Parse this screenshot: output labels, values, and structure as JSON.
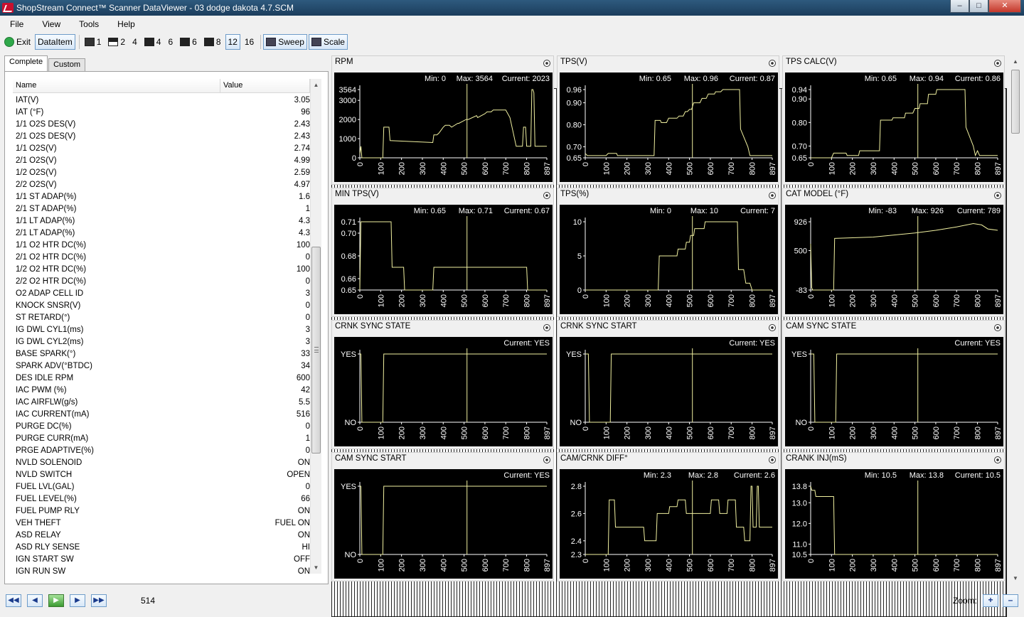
{
  "window": {
    "title": "ShopStream Connect™ Scanner DataViewer - 03 dodge dakota 4.7.SCM"
  },
  "menu": [
    "File",
    "View",
    "Tools",
    "Help"
  ],
  "toolbar": {
    "exit_label": "Exit",
    "dataitem_label": "DataItem",
    "layouts": [
      "1",
      "2",
      "4",
      "4",
      "6",
      "6",
      "8",
      "12",
      "16"
    ],
    "active_layout": "12",
    "sweep_label": "Sweep",
    "scale_label": "Scale"
  },
  "tabs": [
    {
      "label": "Complete",
      "active": true
    },
    {
      "label": "Custom",
      "active": false
    }
  ],
  "list": {
    "headers": {
      "name": "Name",
      "value": "Value"
    },
    "rows": [
      [
        "IAT(V)",
        "3.05"
      ],
      [
        "IAT (°F)",
        "96"
      ],
      [
        "1/1 O2S DES(V)",
        "2.43"
      ],
      [
        "2/1 O2S DES(V)",
        "2.43"
      ],
      [
        "1/1 O2S(V)",
        "2.74"
      ],
      [
        "2/1 O2S(V)",
        "4.99"
      ],
      [
        "1/2 O2S(V)",
        "2.59"
      ],
      [
        "2/2 O2S(V)",
        "4.97"
      ],
      [
        "1/1 ST ADAP(%)",
        "1.6"
      ],
      [
        "2/1 ST ADAP(%)",
        "1"
      ],
      [
        "1/1 LT ADAP(%)",
        "4.3"
      ],
      [
        "2/1 LT ADAP(%)",
        "4.3"
      ],
      [
        "1/1 O2 HTR DC(%)",
        "100"
      ],
      [
        "2/1 O2 HTR DC(%)",
        "0"
      ],
      [
        "1/2 O2 HTR DC(%)",
        "100"
      ],
      [
        "2/2 O2 HTR DC(%)",
        "0"
      ],
      [
        "O2 ADAP CELL ID",
        "3"
      ],
      [
        "KNOCK SNSR(V)",
        "0"
      ],
      [
        "ST RETARD(°)",
        "0"
      ],
      [
        "IG DWL CYL1(ms)",
        "3"
      ],
      [
        "IG DWL CYL2(ms)",
        "3"
      ],
      [
        "BASE SPARK(°)",
        "33"
      ],
      [
        "SPARK ADV(°BTDC)",
        "34"
      ],
      [
        "DES IDLE RPM",
        "600"
      ],
      [
        "IAC PWM (%)",
        "42"
      ],
      [
        "IAC AIRFLW(g/s)",
        "5.5"
      ],
      [
        "IAC CURRENT(mA)",
        "516"
      ],
      [
        "PURGE DC(%)",
        "0"
      ],
      [
        "PURGE CURR(mA)",
        "1"
      ],
      [
        "PRGE ADAPTIVE(%)",
        "0"
      ],
      [
        "NVLD SOLENOID",
        "ON"
      ],
      [
        "NVLD SWITCH",
        "OPEN"
      ],
      [
        "FUEL LVL(GAL)",
        "0"
      ],
      [
        "FUEL LEVEL(%)",
        "66"
      ],
      [
        "FUEL PUMP RLY",
        "ON"
      ],
      [
        "VEH THEFT",
        "FUEL ON"
      ],
      [
        "ASD RELAY",
        "ON"
      ],
      [
        "ASD RLY SENSE",
        "HI"
      ],
      [
        "IGN START SW",
        "OFF"
      ],
      [
        "IGN RUN SW",
        "ON"
      ]
    ]
  },
  "x_ticks": [
    "0",
    "100",
    "200",
    "300",
    "400",
    "500",
    "600",
    "700",
    "800",
    "897"
  ],
  "chart_data": [
    {
      "type": "line",
      "title": "RPM",
      "stats": {
        "min": "Min: 0",
        "max": "Max: 3564",
        "current": "Current: 2023"
      },
      "y_ticks": [
        "3564",
        "3000",
        "2000",
        "1000",
        "0"
      ],
      "ylim": [
        0,
        3564
      ],
      "xlim": [
        0,
        897
      ],
      "cursor_x": 514,
      "x": [
        0,
        5,
        10,
        110,
        115,
        140,
        145,
        350,
        355,
        370,
        380,
        400,
        410,
        430,
        440,
        470,
        475,
        510,
        520,
        560,
        565,
        600,
        610,
        630,
        640,
        700,
        720,
        750,
        755,
        780,
        785,
        795,
        800,
        805,
        820,
        825,
        830,
        835,
        840,
        845,
        850,
        860,
        897
      ],
      "y": [
        200,
        600,
        0,
        0,
        1600,
        1600,
        900,
        800,
        1200,
        1200,
        1300,
        1600,
        1700,
        1700,
        1600,
        1800,
        1800,
        2000,
        2000,
        2200,
        2100,
        2300,
        2400,
        2400,
        2500,
        2500,
        2100,
        600,
        600,
        600,
        1600,
        1600,
        600,
        600,
        600,
        3564,
        3564,
        3400,
        600,
        600,
        600,
        600,
        600
      ]
    },
    {
      "type": "line",
      "title": "TPS(V)",
      "stats": {
        "min": "Min: 0.65",
        "max": "Max: 0.96",
        "current": "Current: 0.87"
      },
      "y_ticks": [
        "0.96",
        "0.90",
        "0.80",
        "0.70",
        "0.65"
      ],
      "ylim": [
        0.65,
        0.96
      ],
      "xlim": [
        0,
        897
      ],
      "cursor_x": 514,
      "x": [
        0,
        10,
        15,
        100,
        110,
        150,
        155,
        330,
        335,
        360,
        365,
        390,
        400,
        440,
        450,
        470,
        480,
        490,
        500,
        510,
        520,
        550,
        560,
        580,
        590,
        620,
        625,
        650,
        660,
        740,
        745,
        780,
        790,
        897
      ],
      "y": [
        0.67,
        0.66,
        0.66,
        0.66,
        0.67,
        0.67,
        0.66,
        0.66,
        0.82,
        0.82,
        0.81,
        0.81,
        0.83,
        0.83,
        0.84,
        0.84,
        0.86,
        0.86,
        0.87,
        0.87,
        0.9,
        0.9,
        0.92,
        0.92,
        0.94,
        0.94,
        0.95,
        0.95,
        0.96,
        0.96,
        0.78,
        0.7,
        0.66,
        0.66
      ]
    },
    {
      "type": "line",
      "title": "TPS CALC(V)",
      "stats": {
        "min": "Min: 0.65",
        "max": "Max: 0.94",
        "current": "Current: 0.86"
      },
      "y_ticks": [
        "0.94",
        "0.90",
        "0.80",
        "0.70",
        "0.65"
      ],
      "ylim": [
        0.65,
        0.94
      ],
      "xlim": [
        0,
        897
      ],
      "cursor_x": 514,
      "x": [
        0,
        100,
        110,
        170,
        175,
        230,
        235,
        330,
        335,
        390,
        395,
        450,
        455,
        490,
        500,
        520,
        525,
        560,
        565,
        600,
        605,
        720,
        725,
        740,
        745,
        780,
        790,
        800,
        810,
        897
      ],
      "y": [
        0.65,
        0.65,
        0.67,
        0.67,
        0.66,
        0.66,
        0.68,
        0.68,
        0.81,
        0.81,
        0.82,
        0.82,
        0.84,
        0.84,
        0.86,
        0.86,
        0.88,
        0.88,
        0.92,
        0.92,
        0.94,
        0.94,
        0.94,
        0.94,
        0.78,
        0.7,
        0.66,
        0.68,
        0.66,
        0.66
      ]
    },
    {
      "type": "line",
      "title": "MIN TPS(V)",
      "stats": {
        "min": "Min: 0.65",
        "max": "Max: 0.71",
        "current": "Current: 0.67"
      },
      "y_ticks": [
        "0.71",
        "0.70",
        "0.68",
        "0.66",
        "0.65"
      ],
      "ylim": [
        0.65,
        0.71
      ],
      "xlim": [
        0,
        897
      ],
      "cursor_x": 514,
      "x": [
        0,
        5,
        10,
        150,
        155,
        210,
        215,
        350,
        355,
        800,
        805,
        897
      ],
      "y": [
        0.65,
        0.71,
        0.71,
        0.71,
        0.67,
        0.67,
        0.65,
        0.65,
        0.67,
        0.67,
        0.65,
        0.65
      ]
    },
    {
      "type": "line",
      "title": "TPS(%)",
      "stats": {
        "min": "Min: 0",
        "max": "Max: 10",
        "current": "Current: 7"
      },
      "y_ticks": [
        "10",
        "5",
        "0"
      ],
      "ylim": [
        0,
        10
      ],
      "xlim": [
        0,
        897
      ],
      "cursor_x": 514,
      "x": [
        0,
        350,
        355,
        440,
        445,
        480,
        485,
        500,
        505,
        520,
        525,
        570,
        575,
        620,
        625,
        730,
        735,
        760,
        770,
        790,
        800,
        897
      ],
      "y": [
        0,
        0,
        5,
        5,
        6,
        6,
        7,
        7,
        8,
        8,
        9,
        9,
        10,
        10,
        10,
        10,
        3,
        3,
        1,
        1,
        0,
        0
      ]
    },
    {
      "type": "line",
      "title": "CAT MODEL (°F)",
      "stats": {
        "min": "Min: -83",
        "max": "Max: 926",
        "current": "Current: 789"
      },
      "y_ticks": [
        "926",
        "500",
        "-83"
      ],
      "ylim": [
        -83,
        926
      ],
      "xlim": [
        0,
        897
      ],
      "cursor_x": 514,
      "x": [
        0,
        5,
        10,
        110,
        115,
        300,
        400,
        500,
        600,
        700,
        780,
        820,
        850,
        897
      ],
      "y": [
        600,
        -50,
        -83,
        -83,
        680,
        700,
        730,
        760,
        800,
        850,
        900,
        880,
        820,
        800
      ]
    },
    {
      "type": "line",
      "title": "CRNK SYNC STATE",
      "stats": {
        "current": "Current: YES"
      },
      "y_ticks": [
        "YES",
        "NO"
      ],
      "ylim": [
        0,
        1
      ],
      "xlim": [
        0,
        897
      ],
      "cursor_x": 514,
      "x": [
        0,
        5,
        10,
        110,
        115,
        897
      ],
      "y": [
        1,
        1,
        0,
        0,
        1,
        1
      ]
    },
    {
      "type": "line",
      "title": "CRNK SYNC START",
      "stats": {
        "current": "Current: YES"
      },
      "y_ticks": [
        "YES",
        "NO"
      ],
      "ylim": [
        0,
        1
      ],
      "xlim": [
        0,
        897
      ],
      "cursor_x": 514,
      "x": [
        0,
        15,
        20,
        120,
        125,
        897
      ],
      "y": [
        1,
        1,
        0,
        0,
        1,
        1
      ]
    },
    {
      "type": "line",
      "title": "CAM SYNC STATE",
      "stats": {
        "current": "Current: YES"
      },
      "y_ticks": [
        "YES",
        "NO"
      ],
      "ylim": [
        0,
        1
      ],
      "xlim": [
        0,
        897
      ],
      "cursor_x": 514,
      "x": [
        0,
        15,
        20,
        120,
        125,
        897
      ],
      "y": [
        1,
        1,
        0,
        0,
        1,
        1
      ]
    },
    {
      "type": "line",
      "title": "CAM SYNC START",
      "stats": {
        "current": "Current: YES"
      },
      "y_ticks": [
        "YES",
        "NO"
      ],
      "ylim": [
        0,
        1
      ],
      "xlim": [
        0,
        897
      ],
      "cursor_x": 514,
      "x": [
        0,
        5,
        10,
        110,
        115,
        897
      ],
      "y": [
        1,
        1,
        0,
        0,
        1,
        1
      ]
    },
    {
      "type": "line",
      "title": "CAM/CRNK DIFF°",
      "stats": {
        "min": "Min: 2.3",
        "max": "Max: 2.8",
        "current": "Current: 2.6"
      },
      "y_ticks": [
        "2.8",
        "2.6",
        "2.4",
        "2.3"
      ],
      "ylim": [
        2.3,
        2.8
      ],
      "xlim": [
        0,
        897
      ],
      "cursor_x": 514,
      "x": [
        0,
        110,
        115,
        140,
        145,
        280,
        285,
        340,
        345,
        360,
        365,
        400,
        405,
        440,
        445,
        480,
        485,
        530,
        535,
        600,
        605,
        640,
        645,
        660,
        665,
        680,
        685,
        720,
        725,
        760,
        765,
        790,
        795,
        800,
        805,
        820,
        825,
        830,
        835,
        850,
        855,
        897
      ],
      "y": [
        2.3,
        2.3,
        2.7,
        2.7,
        2.5,
        2.5,
        2.4,
        2.4,
        2.6,
        2.6,
        2.6,
        2.6,
        2.65,
        2.65,
        2.7,
        2.7,
        2.6,
        2.6,
        2.6,
        2.6,
        2.7,
        2.7,
        2.6,
        2.6,
        2.6,
        2.6,
        2.7,
        2.7,
        2.5,
        2.5,
        2.4,
        2.4,
        2.8,
        2.8,
        2.5,
        2.5,
        2.8,
        2.8,
        2.5,
        2.5,
        2.5,
        2.5
      ]
    },
    {
      "type": "line",
      "title": "CRANK INJ(mS)",
      "stats": {
        "min": "Min: 10.5",
        "max": "Max: 13.8",
        "current": "Current: 10.5"
      },
      "y_ticks": [
        "13.8",
        "13.0",
        "12.0",
        "11.0",
        "10.5"
      ],
      "ylim": [
        10.5,
        13.8
      ],
      "xlim": [
        0,
        897
      ],
      "cursor_x": 514,
      "x": [
        0,
        5,
        20,
        25,
        110,
        115,
        897
      ],
      "y": [
        13.8,
        13.6,
        13.6,
        13.3,
        13.3,
        10.5,
        10.5
      ]
    }
  ],
  "bottom": {
    "frame": "514",
    "zoom_label": "Zoom:",
    "nav": [
      "|◀◀",
      "◀",
      "▶",
      "▶|",
      "▶▶|"
    ]
  }
}
